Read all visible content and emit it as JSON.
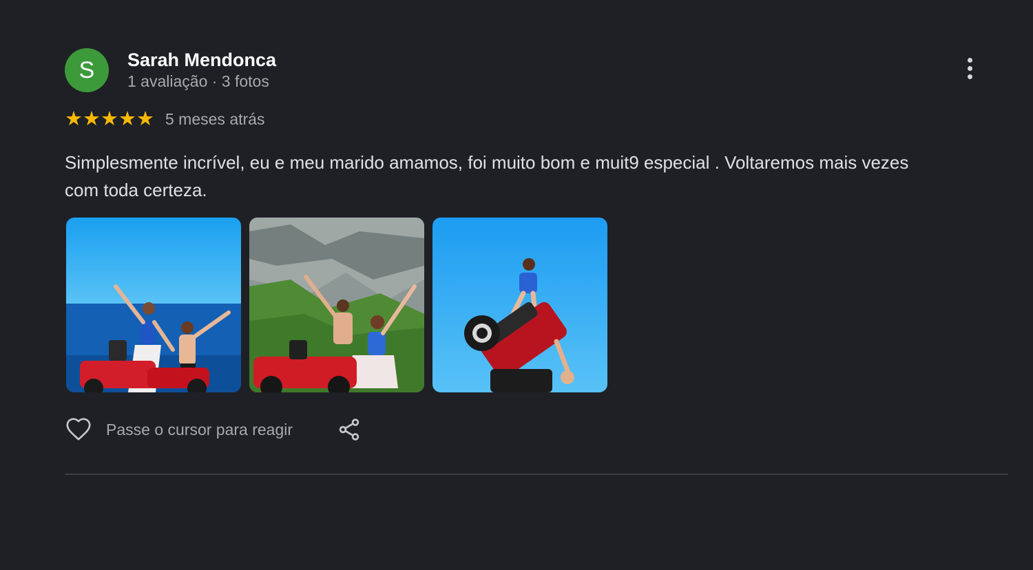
{
  "review": {
    "author": {
      "initial": "S",
      "name": "Sarah Mendonca",
      "meta": "1 avaliação · 3 fotos",
      "avatar_color": "#3c9a3a"
    },
    "rating": 5,
    "rating_stars": "★★★★★",
    "time_ago": "5 meses atrás",
    "text": "Simplesmente incrível, eu e meu marido amamos, foi muito bom e muit9 especial . Voltaremos mais vezes com toda certeza.",
    "photos": [
      {
        "icon": "photo-couple-sea"
      },
      {
        "icon": "photo-couple-cliff"
      },
      {
        "icon": "photo-atv-stunt"
      }
    ],
    "actions": {
      "react_label": "Passe o cursor para reagir",
      "react_icon": "heart-icon",
      "share_icon": "share-icon"
    },
    "more_icon": "more-vert-icon",
    "colors": {
      "background": "#1f2025",
      "star": "#f8b900",
      "muted_text": "#a6a9ae"
    }
  }
}
